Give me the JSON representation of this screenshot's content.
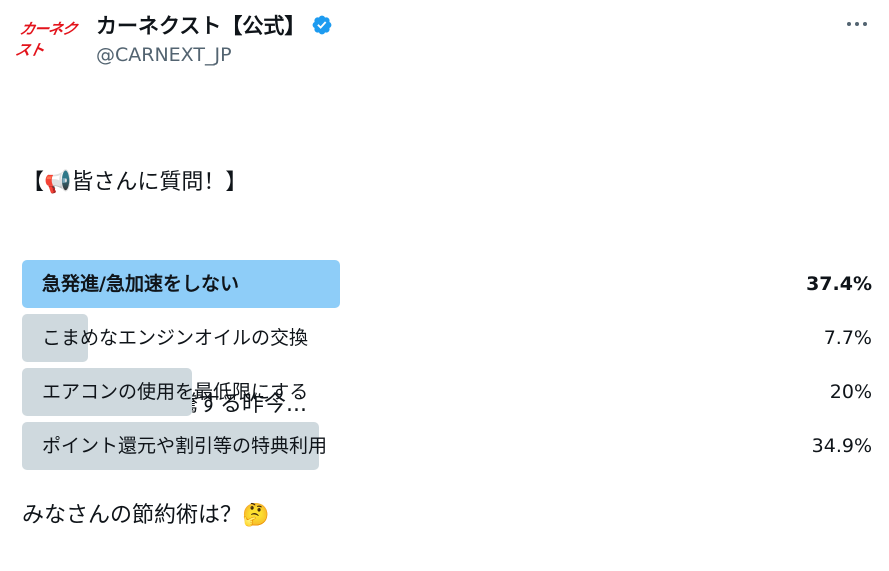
{
  "account": {
    "display_name": "カーネクスト【公式】",
    "handle": "@CARNEXT_JP",
    "avatar_text": "カーネクスト",
    "verified": true
  },
  "tweet": {
    "line1": "【📢皆さんに質問！】",
    "line2": "ガソリン代が高騰する昨今...",
    "line3": "みなさんの節約術は？🤔"
  },
  "poll": {
    "options": [
      {
        "label": "急発進/急加速をしない",
        "percent_text": "37.4%",
        "percent": 37.4,
        "winner": true
      },
      {
        "label": "こまめなエンジンオイルの交換",
        "percent_text": "7.7%",
        "percent": 7.7,
        "winner": false
      },
      {
        "label": "エアコンの使用を最低限にする",
        "percent_text": "20%",
        "percent": 20,
        "winner": false
      },
      {
        "label": "ポイント還元や割引等の特典利用",
        "percent_text": "34.9%",
        "percent": 34.9,
        "winner": false
      }
    ]
  },
  "colors": {
    "winner_bar": "#8ecdf8",
    "other_bar": "#cfd9de",
    "verified": "#1d9bf0",
    "logo": "#e3131b"
  },
  "icons": {
    "more": "more-horizontal-icon",
    "verified": "verified-badge-icon"
  }
}
